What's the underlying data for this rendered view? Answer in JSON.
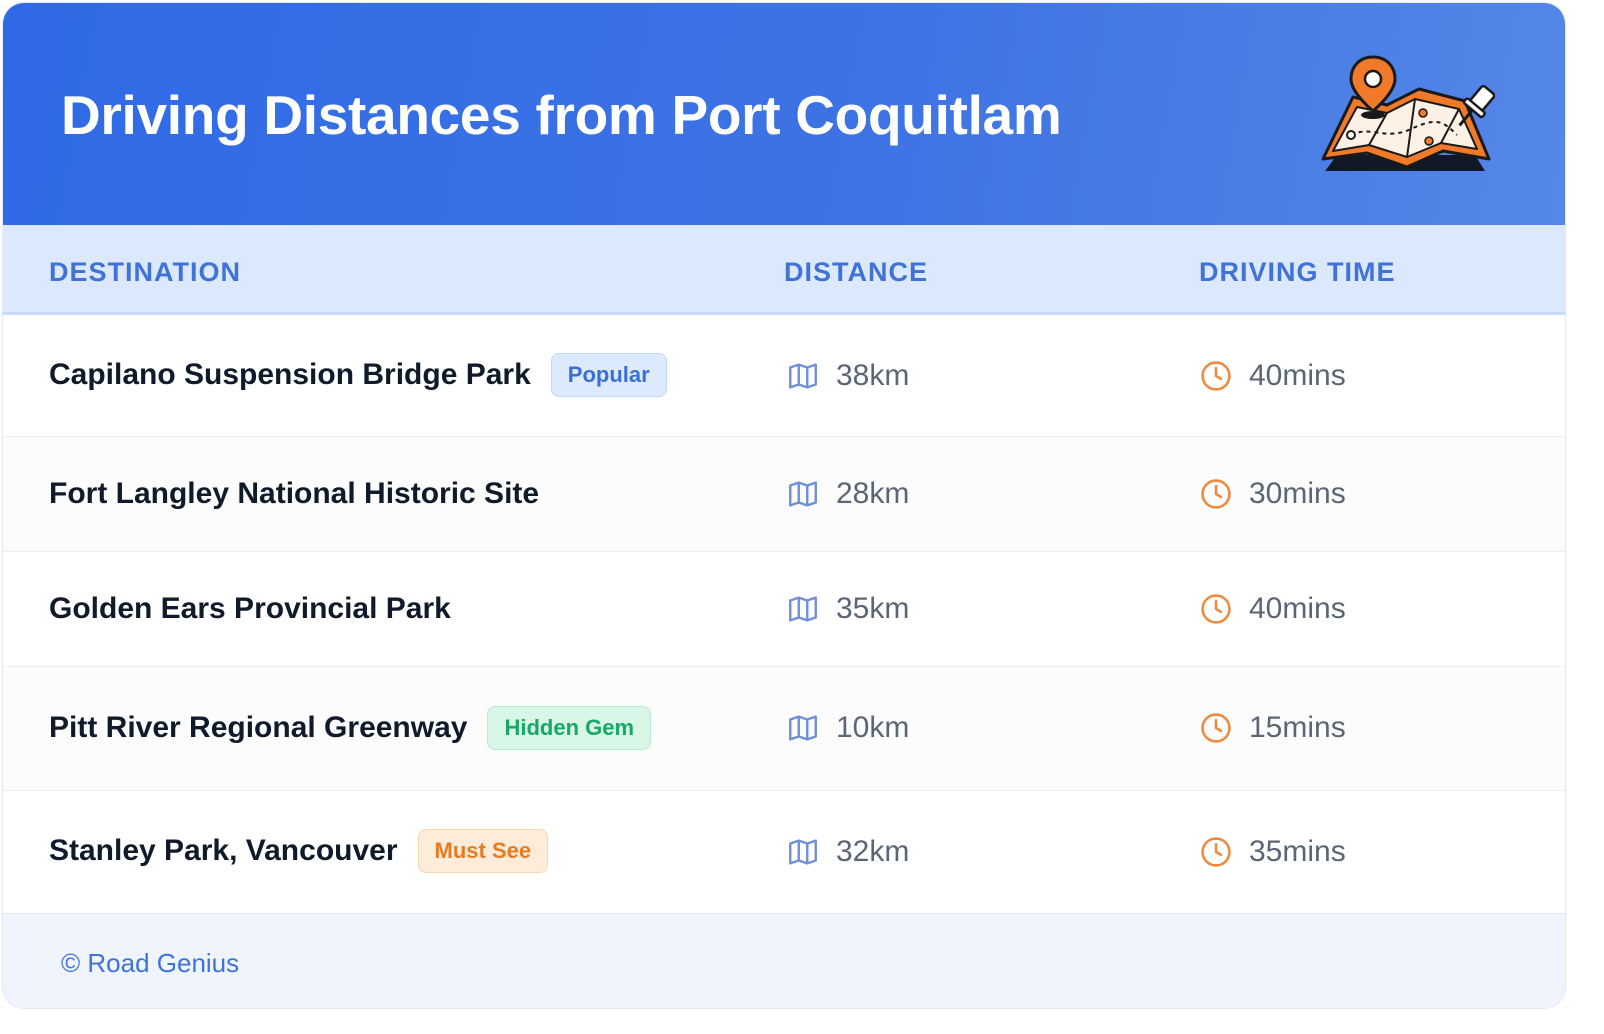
{
  "header": {
    "title": "Driving Distances from Port Coquitlam"
  },
  "table": {
    "columns": {
      "destination": "DESTINATION",
      "distance": "DISTANCE",
      "driving_time": "DRIVING TIME"
    },
    "rows": [
      {
        "destination": "Capilano Suspension Bridge Park",
        "badge": "Popular",
        "distance": "38km",
        "time": "40mins"
      },
      {
        "destination": "Fort Langley National Historic Site",
        "badge": "",
        "distance": "28km",
        "time": "30mins"
      },
      {
        "destination": "Golden Ears Provincial Park",
        "badge": "",
        "distance": "35km",
        "time": "40mins"
      },
      {
        "destination": "Pitt River Regional Greenway",
        "badge": "Hidden Gem",
        "distance": "10km",
        "time": "15mins"
      },
      {
        "destination": "Stanley Park, Vancouver",
        "badge": "Must See",
        "distance": "32km",
        "time": "35mins"
      }
    ]
  },
  "footer": {
    "text": "© Road Genius"
  },
  "colors": {
    "header_blue": "#2f6ae6",
    "accent_blue": "#3f73d9",
    "clock_orange": "#ef8a3c",
    "badge_green": "#17a866",
    "badge_orange": "#ea7a1f"
  },
  "icons": [
    "map-illustration-icon",
    "map-icon",
    "clock-icon"
  ]
}
